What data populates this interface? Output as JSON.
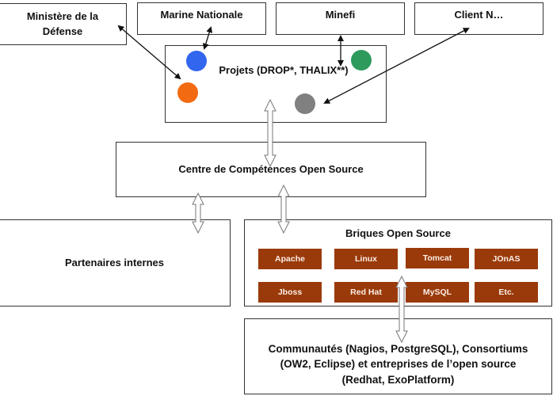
{
  "diagram": {
    "clients": [
      {
        "id": "defense",
        "label": "Ministère de la Défense"
      },
      {
        "id": "marine",
        "label": "Marine Nationale"
      },
      {
        "id": "minefi",
        "label": "Minefi"
      },
      {
        "id": "client-n",
        "label": "Client N…"
      }
    ],
    "projects": {
      "label": "Projets (DROP*, THALIX**)",
      "dots": [
        {
          "name": "blue",
          "color": "#3366ee"
        },
        {
          "name": "orange",
          "color": "#f26a12"
        },
        {
          "name": "green",
          "color": "#2e9a5c"
        },
        {
          "name": "gray",
          "color": "#808080"
        }
      ]
    },
    "competence_center": {
      "label": "Centre de Compétences Open Source"
    },
    "internal_partners": {
      "label": "Partenaires internes"
    },
    "bricks": {
      "title": "Briques Open Source",
      "color": "#9a3a0a",
      "items": [
        "Apache",
        "Linux",
        "Tomcat",
        "JOnAS",
        "Jboss",
        "Red Hat",
        "MySQL",
        "Etc."
      ]
    },
    "communities": {
      "lines": [
        "Communautés (Nagios, PostgreSQL), Consortiums",
        "(OW2, Eclipse) et entreprises de l’open source",
        "(Redhat, ExoPlatform)"
      ]
    }
  }
}
